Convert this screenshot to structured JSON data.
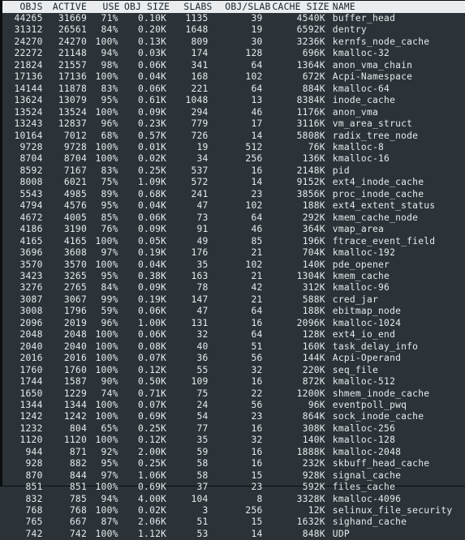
{
  "app": {
    "name": "slabtop",
    "background_color": "#2b3338",
    "text_color": "#e6eaec",
    "header_background_color": "#e9edf0",
    "header_text_color": "#1b2125"
  },
  "table": {
    "headers": [
      "OBJS",
      "ACTIVE",
      "USE",
      "OBJ SIZE",
      "SLABS",
      "OBJ/SLAB",
      "CACHE SIZE",
      "NAME"
    ],
    "rows": [
      {
        "objs": "44265",
        "active": "31669",
        "use": "71%",
        "obj_size": "0.10K",
        "slabs": "1135",
        "obj_per_slab": "39",
        "cache_size": "4540K",
        "name": "buffer_head"
      },
      {
        "objs": "31312",
        "active": "26561",
        "use": "84%",
        "obj_size": "0.20K",
        "slabs": "1648",
        "obj_per_slab": "19",
        "cache_size": "6592K",
        "name": "dentry"
      },
      {
        "objs": "24270",
        "active": "24270",
        "use": "100%",
        "obj_size": "0.13K",
        "slabs": "809",
        "obj_per_slab": "30",
        "cache_size": "3236K",
        "name": "kernfs_node_cache"
      },
      {
        "objs": "22272",
        "active": "21148",
        "use": "94%",
        "obj_size": "0.03K",
        "slabs": "174",
        "obj_per_slab": "128",
        "cache_size": "696K",
        "name": "kmalloc-32"
      },
      {
        "objs": "21824",
        "active": "21557",
        "use": "98%",
        "obj_size": "0.06K",
        "slabs": "341",
        "obj_per_slab": "64",
        "cache_size": "1364K",
        "name": "anon_vma_chain"
      },
      {
        "objs": "17136",
        "active": "17136",
        "use": "100%",
        "obj_size": "0.04K",
        "slabs": "168",
        "obj_per_slab": "102",
        "cache_size": "672K",
        "name": "Acpi-Namespace"
      },
      {
        "objs": "14144",
        "active": "11878",
        "use": "83%",
        "obj_size": "0.06K",
        "slabs": "221",
        "obj_per_slab": "64",
        "cache_size": "884K",
        "name": "kmalloc-64"
      },
      {
        "objs": "13624",
        "active": "13079",
        "use": "95%",
        "obj_size": "0.61K",
        "slabs": "1048",
        "obj_per_slab": "13",
        "cache_size": "8384K",
        "name": "inode_cache"
      },
      {
        "objs": "13524",
        "active": "13524",
        "use": "100%",
        "obj_size": "0.09K",
        "slabs": "294",
        "obj_per_slab": "46",
        "cache_size": "1176K",
        "name": "anon_vma"
      },
      {
        "objs": "13243",
        "active": "12837",
        "use": "96%",
        "obj_size": "0.23K",
        "slabs": "779",
        "obj_per_slab": "17",
        "cache_size": "3116K",
        "name": "vm_area_struct"
      },
      {
        "objs": "10164",
        "active": "7012",
        "use": "68%",
        "obj_size": "0.57K",
        "slabs": "726",
        "obj_per_slab": "14",
        "cache_size": "5808K",
        "name": "radix_tree_node"
      },
      {
        "objs": "9728",
        "active": "9728",
        "use": "100%",
        "obj_size": "0.01K",
        "slabs": "19",
        "obj_per_slab": "512",
        "cache_size": "76K",
        "name": "kmalloc-8"
      },
      {
        "objs": "8704",
        "active": "8704",
        "use": "100%",
        "obj_size": "0.02K",
        "slabs": "34",
        "obj_per_slab": "256",
        "cache_size": "136K",
        "name": "kmalloc-16"
      },
      {
        "objs": "8592",
        "active": "7167",
        "use": "83%",
        "obj_size": "0.25K",
        "slabs": "537",
        "obj_per_slab": "16",
        "cache_size": "2148K",
        "name": "pid"
      },
      {
        "objs": "8008",
        "active": "6021",
        "use": "75%",
        "obj_size": "1.09K",
        "slabs": "572",
        "obj_per_slab": "14",
        "cache_size": "9152K",
        "name": "ext4_inode_cache"
      },
      {
        "objs": "5543",
        "active": "4985",
        "use": "89%",
        "obj_size": "0.68K",
        "slabs": "241",
        "obj_per_slab": "23",
        "cache_size": "3856K",
        "name": "proc_inode_cache"
      },
      {
        "objs": "4794",
        "active": "4576",
        "use": "95%",
        "obj_size": "0.04K",
        "slabs": "47",
        "obj_per_slab": "102",
        "cache_size": "188K",
        "name": "ext4_extent_status"
      },
      {
        "objs": "4672",
        "active": "4005",
        "use": "85%",
        "obj_size": "0.06K",
        "slabs": "73",
        "obj_per_slab": "64",
        "cache_size": "292K",
        "name": "kmem_cache_node"
      },
      {
        "objs": "4186",
        "active": "3190",
        "use": "76%",
        "obj_size": "0.09K",
        "slabs": "91",
        "obj_per_slab": "46",
        "cache_size": "364K",
        "name": "vmap_area"
      },
      {
        "objs": "4165",
        "active": "4165",
        "use": "100%",
        "obj_size": "0.05K",
        "slabs": "49",
        "obj_per_slab": "85",
        "cache_size": "196K",
        "name": "ftrace_event_field"
      },
      {
        "objs": "3696",
        "active": "3608",
        "use": "97%",
        "obj_size": "0.19K",
        "slabs": "176",
        "obj_per_slab": "21",
        "cache_size": "704K",
        "name": "kmalloc-192"
      },
      {
        "objs": "3570",
        "active": "3570",
        "use": "100%",
        "obj_size": "0.04K",
        "slabs": "35",
        "obj_per_slab": "102",
        "cache_size": "140K",
        "name": "pde_opener"
      },
      {
        "objs": "3423",
        "active": "3265",
        "use": "95%",
        "obj_size": "0.38K",
        "slabs": "163",
        "obj_per_slab": "21",
        "cache_size": "1304K",
        "name": "kmem_cache"
      },
      {
        "objs": "3276",
        "active": "2765",
        "use": "84%",
        "obj_size": "0.09K",
        "slabs": "78",
        "obj_per_slab": "42",
        "cache_size": "312K",
        "name": "kmalloc-96"
      },
      {
        "objs": "3087",
        "active": "3067",
        "use": "99%",
        "obj_size": "0.19K",
        "slabs": "147",
        "obj_per_slab": "21",
        "cache_size": "588K",
        "name": "cred_jar"
      },
      {
        "objs": "3008",
        "active": "1796",
        "use": "59%",
        "obj_size": "0.06K",
        "slabs": "47",
        "obj_per_slab": "64",
        "cache_size": "188K",
        "name": "ebitmap_node"
      },
      {
        "objs": "2096",
        "active": "2019",
        "use": "96%",
        "obj_size": "1.00K",
        "slabs": "131",
        "obj_per_slab": "16",
        "cache_size": "2096K",
        "name": "kmalloc-1024"
      },
      {
        "objs": "2048",
        "active": "2048",
        "use": "100%",
        "obj_size": "0.06K",
        "slabs": "32",
        "obj_per_slab": "64",
        "cache_size": "128K",
        "name": "ext4_io_end"
      },
      {
        "objs": "2040",
        "active": "2040",
        "use": "100%",
        "obj_size": "0.08K",
        "slabs": "40",
        "obj_per_slab": "51",
        "cache_size": "160K",
        "name": "task_delay_info"
      },
      {
        "objs": "2016",
        "active": "2016",
        "use": "100%",
        "obj_size": "0.07K",
        "slabs": "36",
        "obj_per_slab": "56",
        "cache_size": "144K",
        "name": "Acpi-Operand"
      },
      {
        "objs": "1760",
        "active": "1760",
        "use": "100%",
        "obj_size": "0.12K",
        "slabs": "55",
        "obj_per_slab": "32",
        "cache_size": "220K",
        "name": "seq_file"
      },
      {
        "objs": "1744",
        "active": "1587",
        "use": "90%",
        "obj_size": "0.50K",
        "slabs": "109",
        "obj_per_slab": "16",
        "cache_size": "872K",
        "name": "kmalloc-512"
      },
      {
        "objs": "1650",
        "active": "1229",
        "use": "74%",
        "obj_size": "0.71K",
        "slabs": "75",
        "obj_per_slab": "22",
        "cache_size": "1200K",
        "name": "shmem_inode_cache"
      },
      {
        "objs": "1344",
        "active": "1344",
        "use": "100%",
        "obj_size": "0.07K",
        "slabs": "24",
        "obj_per_slab": "56",
        "cache_size": "96K",
        "name": "eventpoll_pwq"
      },
      {
        "objs": "1242",
        "active": "1242",
        "use": "100%",
        "obj_size": "0.69K",
        "slabs": "54",
        "obj_per_slab": "23",
        "cache_size": "864K",
        "name": "sock_inode_cache"
      },
      {
        "objs": "1232",
        "active": "804",
        "use": "65%",
        "obj_size": "0.25K",
        "slabs": "77",
        "obj_per_slab": "16",
        "cache_size": "308K",
        "name": "kmalloc-256"
      },
      {
        "objs": "1120",
        "active": "1120",
        "use": "100%",
        "obj_size": "0.12K",
        "slabs": "35",
        "obj_per_slab": "32",
        "cache_size": "140K",
        "name": "kmalloc-128"
      },
      {
        "objs": "944",
        "active": "871",
        "use": "92%",
        "obj_size": "2.00K",
        "slabs": "59",
        "obj_per_slab": "16",
        "cache_size": "1888K",
        "name": "kmalloc-2048"
      },
      {
        "objs": "928",
        "active": "882",
        "use": "95%",
        "obj_size": "0.25K",
        "slabs": "58",
        "obj_per_slab": "16",
        "cache_size": "232K",
        "name": "skbuff_head_cache"
      },
      {
        "objs": "870",
        "active": "844",
        "use": "97%",
        "obj_size": "1.06K",
        "slabs": "58",
        "obj_per_slab": "15",
        "cache_size": "928K",
        "name": "signal_cache"
      },
      {
        "objs": "851",
        "active": "851",
        "use": "100%",
        "obj_size": "0.69K",
        "slabs": "37",
        "obj_per_slab": "23",
        "cache_size": "592K",
        "name": "files_cache"
      },
      {
        "objs": "832",
        "active": "785",
        "use": "94%",
        "obj_size": "4.00K",
        "slabs": "104",
        "obj_per_slab": "8",
        "cache_size": "3328K",
        "name": "kmalloc-4096"
      },
      {
        "objs": "768",
        "active": "768",
        "use": "100%",
        "obj_size": "0.02K",
        "slabs": "3",
        "obj_per_slab": "256",
        "cache_size": "12K",
        "name": "selinux_file_security"
      },
      {
        "objs": "765",
        "active": "667",
        "use": "87%",
        "obj_size": "2.06K",
        "slabs": "51",
        "obj_per_slab": "15",
        "cache_size": "1632K",
        "name": "sighand_cache"
      },
      {
        "objs": "742",
        "active": "742",
        "use": "100%",
        "obj_size": "1.12K",
        "slabs": "53",
        "obj_per_slab": "14",
        "cache_size": "848K",
        "name": "UDP"
      }
    ]
  }
}
